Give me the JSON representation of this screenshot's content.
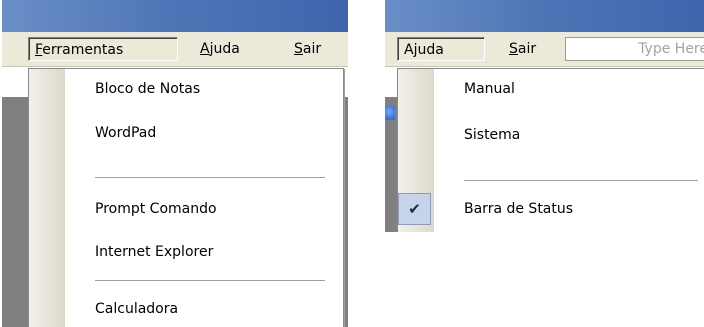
{
  "left_panel": {
    "menubar": {
      "items": [
        {
          "label_pre": "",
          "label_u": "F",
          "label_post": "erramentas"
        },
        {
          "label_pre": "",
          "label_u": "A",
          "label_post": "juda"
        },
        {
          "label_pre": "",
          "label_u": "S",
          "label_post": "air"
        }
      ]
    },
    "menu": {
      "items": [
        {
          "label": "Bloco de Notas"
        },
        {
          "label": "WordPad"
        },
        {
          "label": "Prompt Comando"
        },
        {
          "label": "Internet Explorer"
        },
        {
          "label": "Calculadora"
        }
      ]
    }
  },
  "right_panel": {
    "menubar": {
      "items": [
        {
          "label_pre": "A",
          "label_u": "j",
          "label_post": "uda"
        },
        {
          "label_pre": "",
          "label_u": "S",
          "label_post": "air"
        }
      ],
      "search": {
        "placeholder": "Type Here"
      }
    },
    "menu": {
      "items": [
        {
          "label": "Manual"
        },
        {
          "label": "Sistema"
        },
        {
          "label": "Barra de Status",
          "checked": true
        }
      ],
      "check_glyph": "✔"
    }
  }
}
